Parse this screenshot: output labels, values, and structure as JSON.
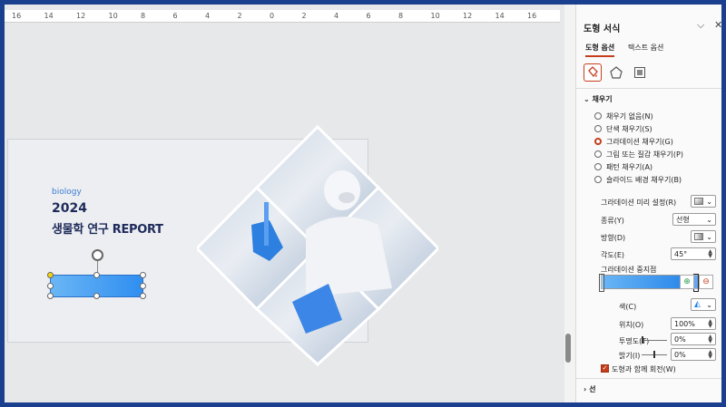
{
  "ruler": {
    "ticks": [
      "16",
      "14",
      "12",
      "10",
      "8",
      "6",
      "4",
      "2",
      "0",
      "2",
      "4",
      "6",
      "8",
      "10",
      "12",
      "14",
      "16"
    ]
  },
  "slide": {
    "subtitle": "biology",
    "year": "2024",
    "title": "생물학 연구 REPORT"
  },
  "panel": {
    "title": "도형 서식",
    "collapse_icon": "⌵",
    "close_icon": "✕",
    "tabs": [
      "도형 옵션",
      "텍스트 옵션"
    ],
    "icons": [
      "fill-line-icon",
      "effects-pentagon-icon",
      "size-properties-icon"
    ],
    "fill_section": "채우기",
    "fill_options": [
      {
        "label": "채우기 없음(N)",
        "selected": false
      },
      {
        "label": "단색 채우기(S)",
        "selected": false
      },
      {
        "label": "그라데이션 채우기(G)",
        "selected": true
      },
      {
        "label": "그림 또는 질감 채우기(P)",
        "selected": false
      },
      {
        "label": "패턴 채우기(A)",
        "selected": false
      },
      {
        "label": "슬라이드 배경 채우기(B)",
        "selected": false
      }
    ],
    "preset_label": "그라데이션 미리 설정(R)",
    "type_label": "종류(Y)",
    "type_value": "선형",
    "direction_label": "방향(D)",
    "angle_label": "각도(E)",
    "angle_value": "45°",
    "stops_label": "그라데이션 중지점",
    "color_label": "색(C)",
    "position_label": "위치(O)",
    "position_value": "100%",
    "transparency_label": "투명도(T)",
    "transparency_value": "0%",
    "brightness_label": "밝기(I)",
    "brightness_value": "0%",
    "rotate_with_shape": "도형과 함께 회전(W)",
    "line_section": "선"
  },
  "colors": {
    "accent": "#c43e1c",
    "shape_start": "#6ab6f5",
    "shape_end": "#2f8ef0",
    "title": "#1e2a5a"
  }
}
